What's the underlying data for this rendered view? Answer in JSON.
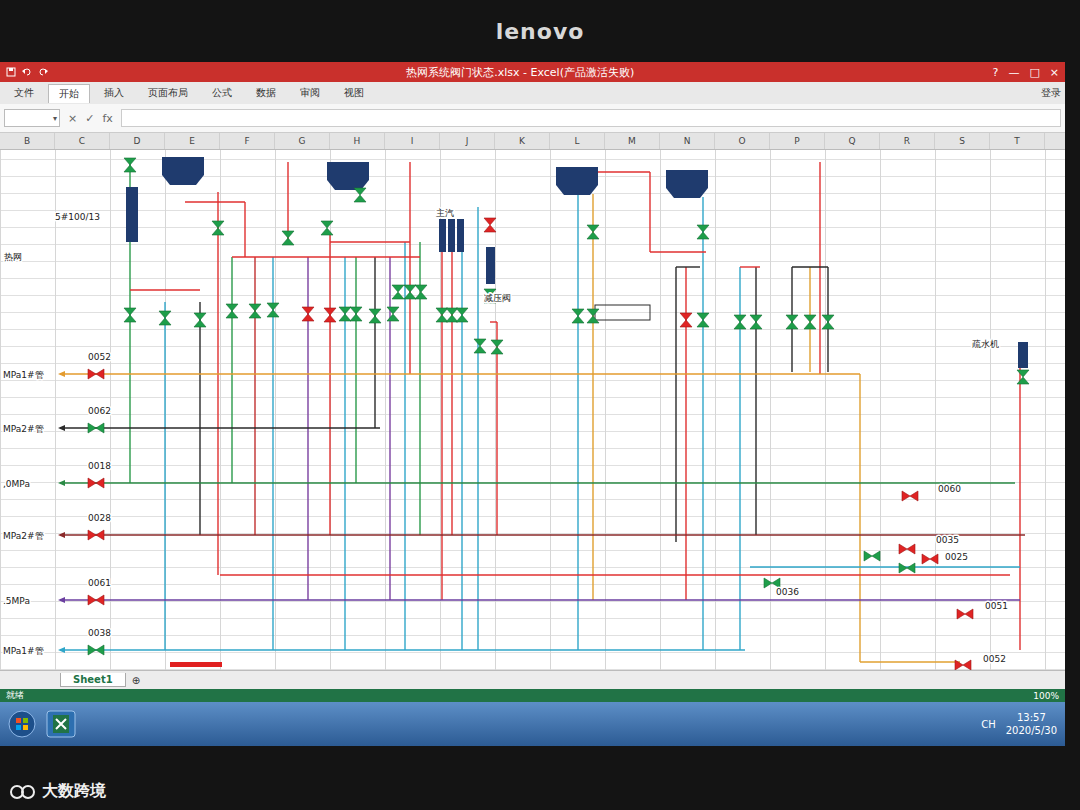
{
  "monitor": {
    "brand": "lenovo"
  },
  "window": {
    "title": "热网系统阀门状态.xlsx - Excel(产品激活失败)",
    "help": "?",
    "minimize": "—",
    "maximize": "□",
    "close": "×"
  },
  "ribbon": {
    "tabs": [
      {
        "label": "文件",
        "selected": false
      },
      {
        "label": "开始",
        "selected": true
      },
      {
        "label": "插入",
        "selected": false
      },
      {
        "label": "页面布局",
        "selected": false
      },
      {
        "label": "公式",
        "selected": false
      },
      {
        "label": "数据",
        "selected": false
      },
      {
        "label": "审阅",
        "selected": false
      },
      {
        "label": "视图",
        "selected": false
      }
    ],
    "login": "登录"
  },
  "formula_bar": {
    "dropdown": "▾",
    "cancel": "×",
    "enter": "✓",
    "fx": "fx"
  },
  "columns": [
    "B",
    "C",
    "D",
    "E",
    "F",
    "G",
    "H",
    "I",
    "J",
    "K",
    "L",
    "M",
    "N",
    "O",
    "P",
    "Q",
    "R",
    "S",
    "T"
  ],
  "diagram": {
    "headers": [
      {
        "code": "0052",
        "label": "MPa1#管",
        "color": "#e39b2e",
        "valve_open": false
      },
      {
        "code": "0062",
        "label": "MPa2#管",
        "color": "#2a2a2a",
        "valve_open": true
      },
      {
        "code": "0018",
        "label": ",0MPa",
        "color": "#2a8a45",
        "valve_open": false
      },
      {
        "code": "0028",
        "label": "MPa2#管",
        "color": "#8a2a2a",
        "valve_open": false
      },
      {
        "code": "0061",
        "label": ".5MPa",
        "color": "#6b3fa0",
        "valve_open": false
      },
      {
        "code": "0038",
        "label": "MPa1#管",
        "color": "#2fa6c9",
        "valve_open": true
      }
    ],
    "right_valves": [
      {
        "code": "0060",
        "open": false
      },
      {
        "code": "0035",
        "open": false
      },
      {
        "code": "0025",
        "open": false
      },
      {
        "code": "0036",
        "open": true
      },
      {
        "code": "0051",
        "open": false
      },
      {
        "code": "0052",
        "open": false
      }
    ],
    "valves": [
      {
        "open": true
      },
      {
        "open": true
      },
      {
        "open": true
      },
      {
        "open": true
      },
      {
        "open": true
      },
      {
        "open": true
      },
      {
        "open": true
      },
      {
        "open": true
      },
      {
        "open": true
      },
      {
        "open": false
      },
      {
        "open": false
      },
      {
        "open": true
      },
      {
        "open": true
      },
      {
        "open": true
      },
      {
        "open": true
      },
      {
        "open": true
      },
      {
        "open": true
      },
      {
        "open": true
      },
      {
        "open": true
      },
      {
        "open": true
      },
      {
        "open": true
      },
      {
        "open": true
      },
      {
        "open": true
      },
      {
        "open": false
      },
      {
        "open": true
      },
      {
        "open": true
      },
      {
        "open": true
      },
      {
        "open": true
      },
      {
        "open": true
      },
      {
        "open": false
      },
      {
        "open": true
      },
      {
        "open": true
      },
      {
        "open": true
      },
      {
        "open": true
      },
      {
        "open": true
      },
      {
        "open": true
      },
      {
        "open": true
      },
      {
        "open": true
      },
      {
        "open": true
      },
      {
        "open": true
      },
      {
        "open": true
      }
    ],
    "labels": [
      "5#100/13",
      "热网",
      "主汽",
      "减压阀",
      "疏水机"
    ]
  },
  "sheet_tabs": [
    {
      "label": "Sheet1",
      "selected": true
    }
  ],
  "add_sheet": "⊕",
  "status_bar": {
    "ready": "就绪",
    "zoom": "100%"
  },
  "taskbar": {
    "lang": "CH",
    "time": "13:57",
    "date": "2020/5/30"
  },
  "watermark": "大数跨境"
}
